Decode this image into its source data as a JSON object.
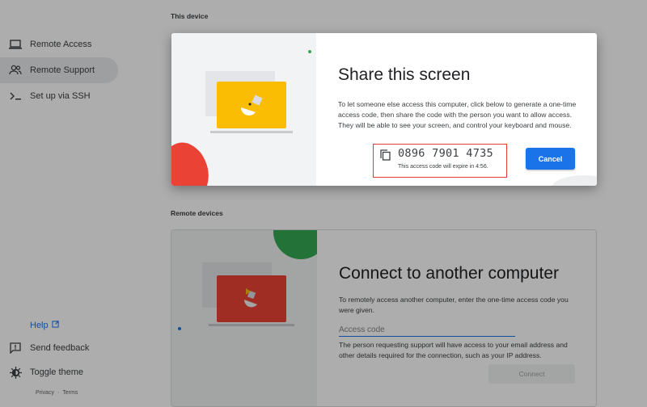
{
  "sidebar": {
    "items": [
      {
        "label": "Remote Access",
        "icon": "laptop-icon"
      },
      {
        "label": "Remote Support",
        "icon": "people-icon"
      },
      {
        "label": "Set up via SSH",
        "icon": "terminal-icon"
      }
    ],
    "help": "Help",
    "feedback": "Send feedback",
    "theme": "Toggle theme",
    "privacy": "Privacy",
    "separator": "·",
    "terms": "Terms"
  },
  "sections": {
    "this_device": "This device",
    "remote_devices": "Remote devices"
  },
  "connect": {
    "title": "Connect to another computer",
    "description": "To remotely access another computer, enter the one-time access code you were given.",
    "input_placeholder": "Access code",
    "note": "The person requesting support will have access to your email address and other details required for the connection, such as your IP address.",
    "button": "Connect"
  },
  "dialog": {
    "title": "Share this screen",
    "description": "To let someone else access this computer, click below to generate a one-time access code, then share the code with the person you want to allow access. They will be able to see your screen, and control your keyboard and mouse.",
    "code": "0896 7901 4735",
    "expire": "This access code will expire in 4:56.",
    "cancel": "Cancel"
  },
  "colors": {
    "accent": "#1a73e8",
    "highlight": "#e53935",
    "yellow": "#fbbc04",
    "red": "#ea4335",
    "green": "#34a853"
  }
}
